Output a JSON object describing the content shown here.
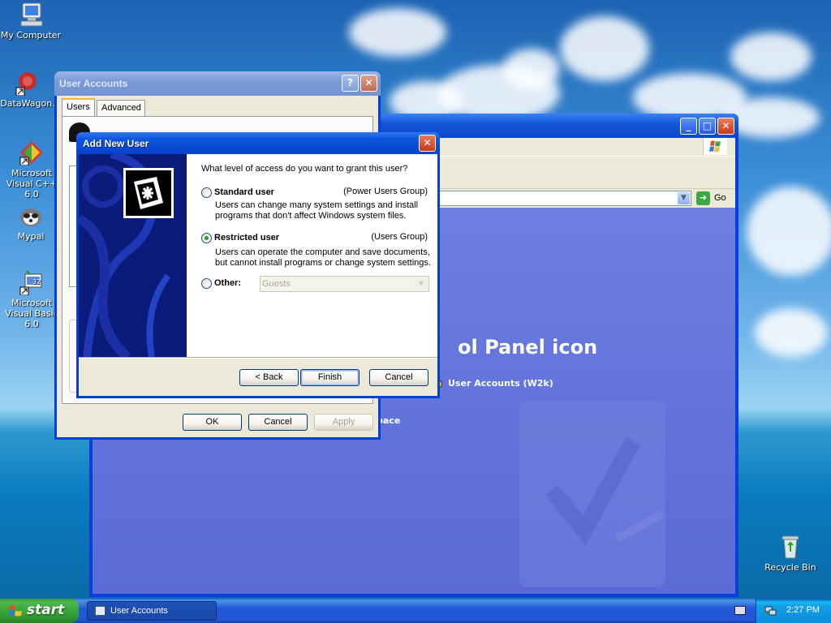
{
  "desktop": {
    "icons": [
      {
        "label": "My Computer"
      },
      {
        "label": "DataWagon."
      },
      {
        "label": "Microsoft Visual C++ 6.0"
      },
      {
        "label": "Mypal"
      },
      {
        "label": "Microsoft Visual Basic 6.0"
      },
      {
        "label": "Recycle Bin"
      }
    ]
  },
  "cp_window": {
    "go_label": "Go",
    "heading_fragment": "ol Panel icon",
    "link_user_accounts": "User Accounts (W2k)",
    "link_fragment": "pace"
  },
  "user_accounts": {
    "title": "User Accounts",
    "tabs": [
      "Users",
      "Advanced"
    ],
    "ok": "OK",
    "cancel": "Cancel",
    "apply": "Apply"
  },
  "add_new_user": {
    "title": "Add New User",
    "question": "What level of access do you want to grant this user?",
    "options": [
      {
        "label": "Standard user",
        "group": "(Power Users Group)",
        "desc1": "Users can change many system settings and install",
        "desc2": "programs that don't affect Windows system files.",
        "checked": false
      },
      {
        "label": "Restricted user",
        "group": "(Users Group)",
        "desc1": "Users can operate the computer and save documents,",
        "desc2": "but cannot install programs or change system settings.",
        "checked": true
      },
      {
        "label": "Other:",
        "checked": false
      }
    ],
    "other_value": "Guests",
    "back": "< Back",
    "finish": "Finish",
    "cancel": "Cancel"
  },
  "taskbar": {
    "start": "start",
    "task_item": "User Accounts",
    "clock": "2:27 PM"
  },
  "colors": {
    "xp_blue": "#0a3ed8",
    "dialog_face": "#ece9d8",
    "start_green": "#36a336"
  }
}
